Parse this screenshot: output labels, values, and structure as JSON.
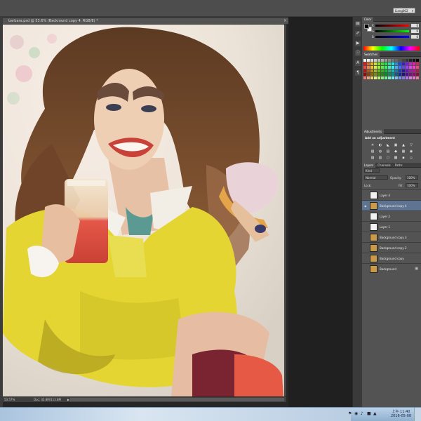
{
  "app": {
    "workspace_value": "Liang002"
  },
  "document": {
    "tab_title": "barbara.psd @ 53.6% (Backround copy 4, RGB/8) *",
    "close_glyph": "×",
    "status_zoom": "53.57%",
    "status_doc": "Doc: 32.8M/113.8M",
    "status_arrow": "▶"
  },
  "color_panel": {
    "tab_label": "Color",
    "channels": [
      {
        "label": "R",
        "value": "0",
        "gradient": [
          "#000000",
          "#ff0000"
        ]
      },
      {
        "label": "G",
        "value": "0",
        "gradient": [
          "#000000",
          "#00ff00"
        ]
      },
      {
        "label": "B",
        "value": "0",
        "gradient": [
          "#000000",
          "#0000ff"
        ]
      }
    ],
    "foreground": "#000000",
    "background": "#ffffff"
  },
  "swatches_panel": {
    "tab_label": "Swatches"
  },
  "adjustments_panel": {
    "tab_label": "Adjustments",
    "heading": "Add an adjustment",
    "icons": [
      "☀",
      "◐",
      "◣",
      "▣",
      "▲",
      "▽",
      "▧",
      "◍",
      "▤",
      "◆",
      "▦",
      "◉",
      "▨",
      "▥",
      "▢",
      "▩",
      "▪",
      "▫"
    ]
  },
  "layers_panel": {
    "tabs": [
      {
        "label": "Layers",
        "active": true
      },
      {
        "label": "Channels",
        "active": false
      },
      {
        "label": "Paths",
        "active": false
      }
    ],
    "kind_filter": "Kind",
    "blend_mode": "Normal",
    "opacity_label": "Opacity:",
    "opacity_value": "100%",
    "lock_label": "Lock:",
    "fill_label": "Fill:",
    "fill_value": "100%",
    "layers": [
      {
        "name": "Layer 4",
        "thumb": "#f2f2f2",
        "visible": false,
        "active": false
      },
      {
        "name": "Background copy 4",
        "thumb": "#c89a4a",
        "visible": true,
        "active": true
      },
      {
        "name": "Layer 2",
        "thumb": "#f2f2f2",
        "visible": false,
        "active": false
      },
      {
        "name": "Layer 1",
        "thumb": "#f2f2f2",
        "visible": false,
        "active": false
      },
      {
        "name": "Background copy 3",
        "thumb": "#c89a4a",
        "visible": false,
        "active": false
      },
      {
        "name": "Background copy 2",
        "thumb": "#c89a4a",
        "visible": false,
        "active": false
      },
      {
        "name": "Background copy",
        "thumb": "#c89a4a",
        "visible": false,
        "active": false
      },
      {
        "name": "Background",
        "thumb": "#c89a4a",
        "visible": false,
        "active": false,
        "locked": true
      }
    ]
  },
  "taskbar": {
    "time": "上午 11:40",
    "date": "2016-05-08",
    "tray_icons": [
      "▲",
      "■",
      "♪",
      "◉",
      "⚑"
    ]
  },
  "colors": {
    "panel_bg": "#535353",
    "selection": "#5e7491",
    "yellow_outfit": "#e3d634",
    "hair": "#6b4427"
  }
}
